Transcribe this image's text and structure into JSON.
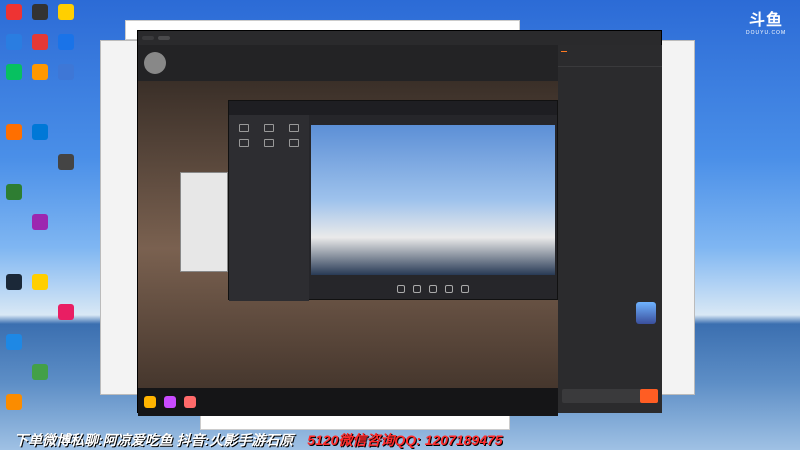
{
  "desktop": {
    "icons": [
      {
        "label": "",
        "color": "#e33"
      },
      {
        "label": "",
        "color": "#333"
      },
      {
        "label": "",
        "color": "#ffcf00"
      },
      {
        "label": "",
        "color": "#2a7de1"
      },
      {
        "label": "",
        "color": "#e53935"
      },
      {
        "label": "",
        "color": "#1a73e8"
      },
      {
        "label": "",
        "color": "#07c160"
      },
      {
        "label": "",
        "color": "#ff9800"
      },
      {
        "label": "",
        "color": "#3e77d6"
      },
      {
        "label": "",
        "color": "#ff6f00"
      },
      {
        "label": "",
        "color": "#0078d7"
      },
      {
        "label": "",
        "color": "#444"
      },
      {
        "label": "",
        "color": "#2e7d32"
      },
      {
        "label": "",
        "color": "#9c27b0"
      },
      {
        "label": "",
        "color": "#1b2838"
      },
      {
        "label": "",
        "color": "#ffcf00"
      },
      {
        "label": "",
        "color": "#e91e63"
      },
      {
        "label": "",
        "color": "#1e88e5"
      },
      {
        "label": "",
        "color": "#43a047"
      },
      {
        "label": "",
        "color": "#fb8c00"
      }
    ]
  },
  "player": {
    "tabs": [
      "",
      ""
    ],
    "streamer_name": "",
    "streamer_sub": "",
    "follow_label": ""
  },
  "chat": {
    "tabs": [
      "",
      "",
      "",
      ""
    ],
    "subtabs": [
      "",
      "",
      ""
    ],
    "ranks": [
      {
        "name": "",
        "val": ""
      },
      {
        "name": "",
        "val": ""
      },
      {
        "name": "",
        "val": ""
      }
    ],
    "system_msg": "",
    "input_placeholder": "",
    "send_label": ""
  },
  "inner_app": {
    "logo": "",
    "version_badge": "",
    "side_tabs": [
      "",
      "",
      ""
    ]
  },
  "douyu_logo": {
    "big": "斗鱼",
    "small": "DOUYU.COM"
  },
  "banner": {
    "left_text": "下单微博私聊:阿凉爱吃鱼 抖音:火影手游石原",
    "right_text": "5120微信咨询QQ: 1207189475"
  },
  "clock": {
    "time": "",
    "date": ""
  }
}
